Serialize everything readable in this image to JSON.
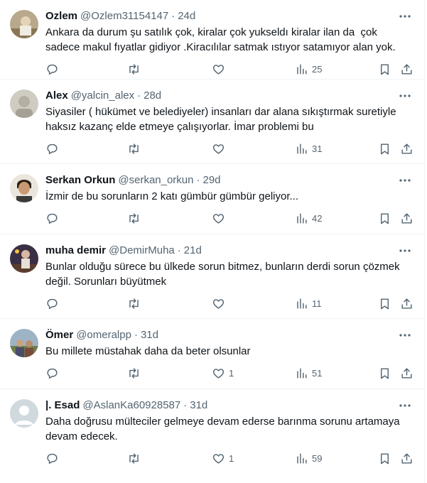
{
  "tweets": [
    {
      "name": "Ozlem",
      "handle": "@Ozlem31154147",
      "separator": "·",
      "time": "24d",
      "text": "Ankara da durum şu satılık çok, kiralar çok yukseldı kiralar ilan da  çok sadece makul fıyatlar gidiyor .Kiracılılar satmak ıstıyor satamıyor alan yok.",
      "likes": "",
      "views": "25",
      "avatar": {
        "bg": "#b8a88c",
        "fg": "#5a4a36"
      }
    },
    {
      "name": "Alex",
      "handle": "@yalcin_alex",
      "separator": "·",
      "time": "28d",
      "text": "Siyasiler ( hükümet ve belediyeler) insanları dar alana sıkıştırmak suretiyle haksız kazanç elde etmeye çalışıyorlar. İmar problemi bu",
      "likes": "",
      "views": "31",
      "avatar": {
        "bg": "#c9c7be",
        "fg": "#9a968a"
      }
    },
    {
      "name": "Serkan Orkun",
      "handle": "@serkan_orkun",
      "separator": "·",
      "time": "29d",
      "text": "İzmir de bu sorunların 2 katı gümbür gümbür geliyor...",
      "likes": "",
      "views": "42",
      "avatar": {
        "bg": "#e8e2d8",
        "fg": "#3b2a1e"
      }
    },
    {
      "name": "muha demir",
      "handle": "@DemirMuha",
      "separator": "·",
      "time": "21d",
      "text": "Bunlar olduğu sürece bu ülkede sorun bitmez, bunların derdi sorun çözmek değil. Sorunları büyütmek",
      "likes": "",
      "views": "11",
      "avatar": {
        "bg": "#3a2f44",
        "fg": "#e0c8b8"
      }
    },
    {
      "name": "Ömer",
      "handle": "@omeralpp",
      "separator": "·",
      "time": "31d",
      "text": "Bu millete müstahak daha da beter olsunlar",
      "likes": "1",
      "views": "51",
      "avatar": {
        "bg": "#8fa6b8",
        "fg": "#4e5a3a"
      }
    },
    {
      "name": "|. Esad",
      "handle": "@AslanKa60928587",
      "separator": "·",
      "time": "31d",
      "text": "Daha doğrusu mülteciler gelmeye devam ederse barınma sorunu artamaya devam edecek.",
      "likes": "1",
      "views": "59",
      "avatar": {
        "bg": "#cfd9de",
        "fg": "#ffffff"
      }
    }
  ]
}
